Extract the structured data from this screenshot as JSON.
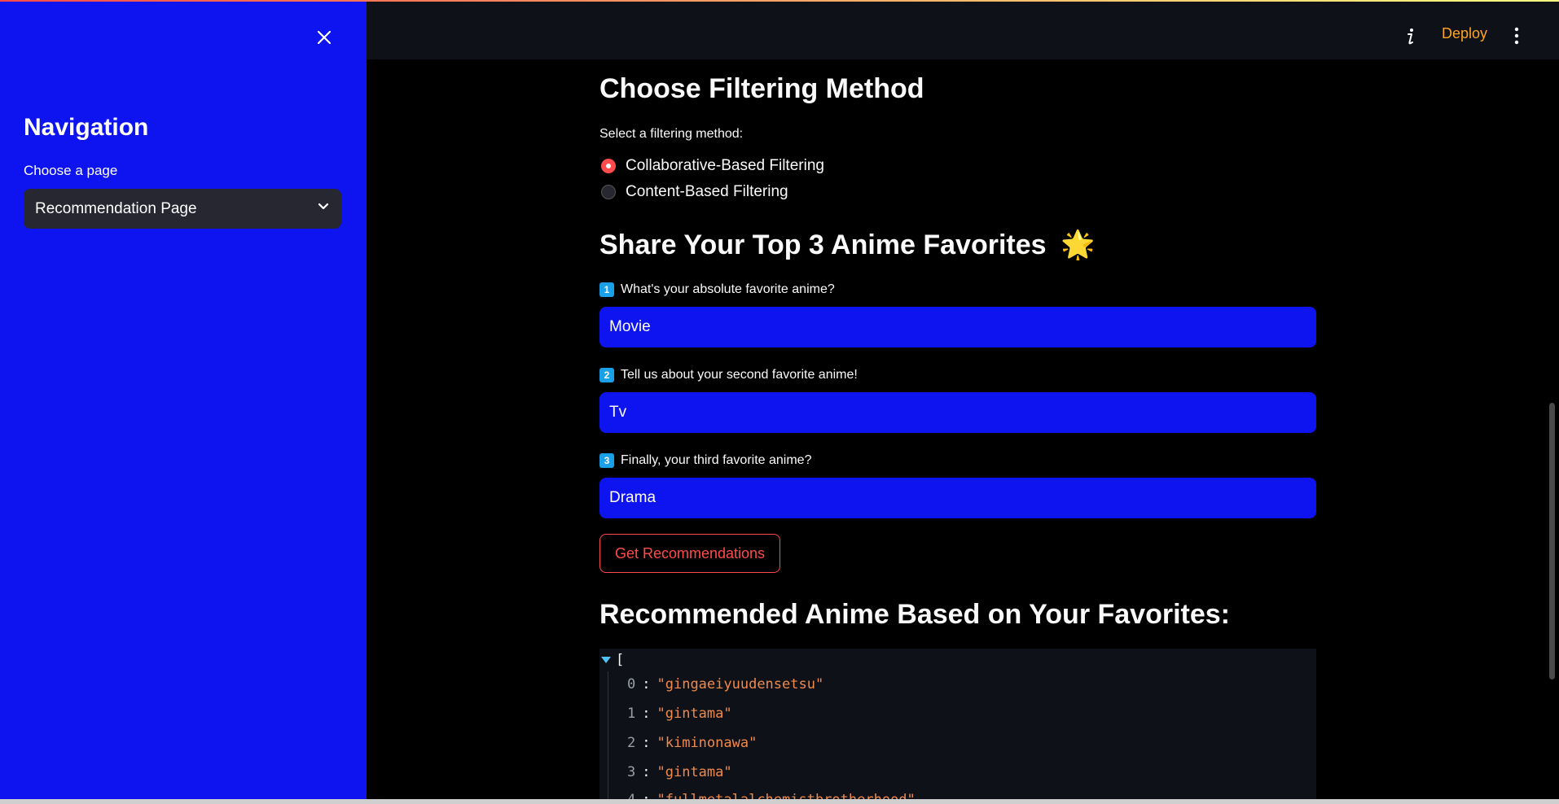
{
  "sidebar": {
    "title": "Navigation",
    "select_label": "Choose a page",
    "select_value": "Recommendation Page"
  },
  "header": {
    "deploy_label": "Deploy"
  },
  "filtering": {
    "heading": "Choose Filtering Method",
    "label": "Select a filtering method:",
    "options": [
      {
        "label": "Collaborative-Based Filtering",
        "selected": true
      },
      {
        "label": "Content-Based Filtering",
        "selected": false
      }
    ]
  },
  "favorites": {
    "heading": "Share Your Top 3 Anime Favorites",
    "heading_emoji": "🌟",
    "fields": [
      {
        "key": "1",
        "label": "What's your absolute favorite anime?",
        "value": "Movie"
      },
      {
        "key": "2",
        "label": "Tell us about your second favorite anime!",
        "value": "Tv"
      },
      {
        "key": "3",
        "label": "Finally, your third favorite anime?",
        "value": "Drama"
      }
    ],
    "button_label": "Get Recommendations"
  },
  "results": {
    "heading": "Recommended Anime Based on Your Favorites:",
    "open_bracket": "[",
    "items": [
      {
        "index": "0",
        "value": "\"gingaeiyuudensetsu\""
      },
      {
        "index": "1",
        "value": "\"gintama\""
      },
      {
        "index": "2",
        "value": "\"kiminonawa\""
      },
      {
        "index": "3",
        "value": "\"gintama\""
      },
      {
        "index": "4",
        "value": "\"fullmetalalchemistbrotherhood\""
      }
    ]
  },
  "colors": {
    "sidebar_bg": "#0d14f0",
    "primary": "#ff4b4b",
    "deploy": "#ffa421"
  }
}
